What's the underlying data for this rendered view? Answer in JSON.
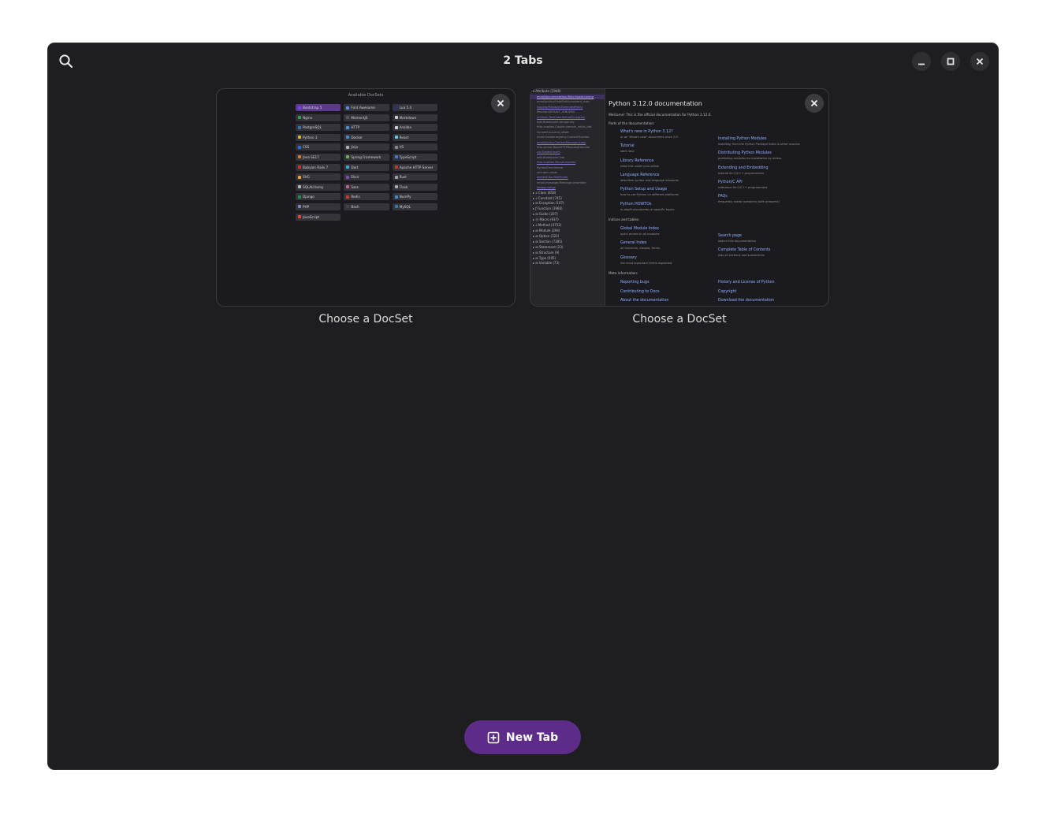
{
  "window": {
    "title": "2 Tabs"
  },
  "icons": {
    "search": "search-icon",
    "minimize": "minimize-icon",
    "maximize": "maximize-icon",
    "close": "close-icon",
    "new_tab": "tab-new-icon"
  },
  "colors": {
    "accent": "#5d2c88",
    "window_bg": "#1e1e21",
    "selected_item": "#5c3a8a",
    "link": "#8fb0ff"
  },
  "tabs": [
    {
      "label": "Choose a DocSet",
      "thumbnail": {
        "heading": "Available DocSets",
        "docsets": [
          {
            "name": "Bootstrap 5",
            "color": "#7b3ff2",
            "selected": true
          },
          {
            "name": "Font Awesome",
            "color": "#5a8de0"
          },
          {
            "name": "Lua 5.4",
            "color": "#2c2c8c"
          },
          {
            "name": "Nginx",
            "color": "#2ca04a"
          },
          {
            "name": "MomentJS",
            "color": "#555555"
          },
          {
            "name": "Markdown",
            "color": "#cccccc"
          },
          {
            "name": "PostgreSQL",
            "color": "#3d6ea8"
          },
          {
            "name": "HTTP",
            "color": "#4a90d9"
          },
          {
            "name": "Ansible",
            "color": "#d0d0d0"
          },
          {
            "name": "Python 3",
            "color": "#d8b63a"
          },
          {
            "name": "Docker",
            "color": "#3a8fd8"
          },
          {
            "name": "React",
            "color": "#5bc8e8"
          },
          {
            "name": "CSS",
            "color": "#2a6fd0"
          },
          {
            "name": "Jinja",
            "color": "#b0b0b0"
          },
          {
            "name": "VS",
            "color": "#888888"
          },
          {
            "name": "Java SE17",
            "color": "#e07a2a"
          },
          {
            "name": "Spring Framework",
            "color": "#6ab04c"
          },
          {
            "name": "TypeScript",
            "color": "#3a7bd5"
          },
          {
            "name": "Babylon Rails 7",
            "color": "#c0392b"
          },
          {
            "name": "Dart",
            "color": "#2ab0d8"
          },
          {
            "name": "Apache HTTP Server",
            "color": "#c0392b"
          },
          {
            "name": "SVG",
            "color": "#e8a33a"
          },
          {
            "name": "Elixir",
            "color": "#7a4ab0"
          },
          {
            "name": "Rust",
            "color": "#a0a0a0"
          },
          {
            "name": "SQLAlchemy",
            "color": "#b5b5b5"
          },
          {
            "name": "Sass",
            "color": "#c06090"
          },
          {
            "name": "Flask",
            "color": "#aaaaaa"
          },
          {
            "name": "Django",
            "color": "#2a8a5a"
          },
          {
            "name": "Redis",
            "color": "#d03a2a"
          },
          {
            "name": "NumPy",
            "color": "#4a8ac8"
          },
          {
            "name": "PHP",
            "color": "#7a86b8"
          },
          {
            "name": "Bash",
            "color": "#444444"
          },
          {
            "name": "MySQL",
            "color": "#3a7aa8"
          },
          {
            "name": "JavaScript",
            "color": "#e04a3a"
          }
        ]
      }
    },
    {
      "label": "Choose a DocSet",
      "thumbnail": {
        "sidebar_lines": [
          {
            "text": "▾ Attribute (1948)",
            "type": "cat"
          },
          {
            "text": "email/documentation/Batchloader.being",
            "type": "selected"
          },
          {
            "text": "email/policy.EmailPolicy.content_man",
            "type": "plain"
          },
          {
            "text": "logging/Manager.ExtendedPolicy",
            "type": "link"
          },
          {
            "text": "filecmp.DEFAULT_IGNORES",
            "type": "plain"
          },
          {
            "text": "unittest.TestCase.failureException",
            "type": "link"
          },
          {
            "text": "bdb.Breakpoint.temporary",
            "type": "plain"
          },
          {
            "text": "http.cookies.Cookie.domain_initial_dot",
            "type": "plain"
          },
          {
            "text": "SyntaxError.end_offset",
            "type": "plain"
          },
          {
            "text": "email.headerregistry.ContentTransfer",
            "type": "plain"
          },
          {
            "text": "email/policy.ContentManager.body",
            "type": "link"
          },
          {
            "text": "http.server.BaseHTTPRequestHandler",
            "type": "plain"
          },
          {
            "text": "csv.Dialect.strict",
            "type": "link"
          },
          {
            "text": "bdb.Breakpoint.line",
            "type": "plain"
          },
          {
            "text": "http.cookies.Morsel.expires",
            "type": "link"
          },
          {
            "text": "SyntaxError.lineno",
            "type": "plain"
          },
          {
            "text": "xml.dom.node",
            "type": "plain"
          },
          {
            "text": "doctest.DocTestFinder",
            "type": "link"
          },
          {
            "text": "email.message.Message.preamble",
            "type": "plain"
          },
          {
            "text": "heapq.merge",
            "type": "link"
          }
        ],
        "sidebar_categories": [
          "▸ ⅃ Class (858)",
          "▸ ⅃ Constant (745)",
          "▸ ⊞ Exception (107)",
          "▸ ƒ Function (3966)",
          "▸ ⊞ Guide (207)",
          "▸ ⓜ Macro (937)",
          "▸ ⅃ Method (4752)",
          "▸ ⊞ Module (294)",
          "▸ ⊞ Option (322)",
          "▸ ⊞ Section (7385)",
          "▸ ⊞ Statement (23)",
          "▸ ⊞ Structure (9)",
          "▸ ⊞ Type (595)",
          "▸ ⊞ Variable (73)"
        ],
        "doc": {
          "title": "Python 3.12.0 documentation",
          "welcome": "Welcome! This is the official documentation for Python 3.12.0.",
          "parts_heading": "Parts of the documentation:",
          "left_links": [
            {
              "link": "What's new in Python 3.12?",
              "note": "or all \"What's new\" documents since 2.0"
            },
            {
              "link": "Tutorial",
              "note": "start here"
            },
            {
              "link": "Library Reference",
              "note": "keep this under your pillow"
            },
            {
              "link": "Language Reference",
              "note": "describes syntax and language elements"
            },
            {
              "link": "Python Setup and Usage",
              "note": "how to use Python on different platforms"
            },
            {
              "link": "Python HOWTOs",
              "note": "in-depth documents on specific topics"
            }
          ],
          "right_links": [
            {
              "link": "Installing Python Modules",
              "note": "installing from the Python Package Index & other sources"
            },
            {
              "link": "Distributing Python Modules",
              "note": "publishing modules for installation by others"
            },
            {
              "link": "Extending and Embedding",
              "note": "tutorial for C/C++ programmers"
            },
            {
              "link": "Python/C API",
              "note": "reference for C/C++ programmers"
            },
            {
              "link": "FAQs",
              "note": "frequently asked questions (with answers!)"
            }
          ],
          "indices_heading": "Indices and tables:",
          "indices_left": [
            {
              "link": "Global Module Index",
              "note": "quick access to all modules"
            },
            {
              "link": "General Index",
              "note": "all functions, classes, terms"
            },
            {
              "link": "Glossary",
              "note": "the most important terms explained"
            }
          ],
          "indices_right": [
            {
              "link": "Search page",
              "note": "search this documentation"
            },
            {
              "link": "Complete Table of Contents",
              "note": "lists all sections and subsections"
            }
          ],
          "meta_heading": "Meta information:",
          "meta_left": [
            "Reporting bugs",
            "Contributing to Docs",
            "About the documentation"
          ],
          "meta_right": [
            "History and License of Python",
            "Copyright",
            "Download the documentation"
          ]
        }
      }
    }
  ],
  "new_tab": {
    "label": "New Tab"
  }
}
